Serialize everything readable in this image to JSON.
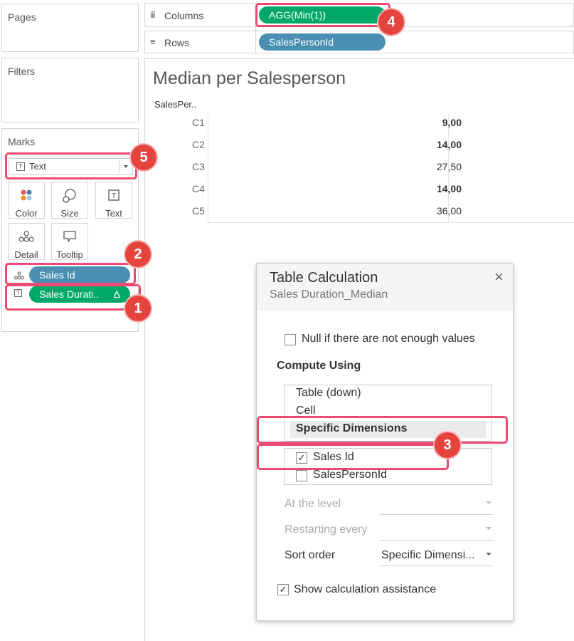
{
  "panels": {
    "pages": "Pages",
    "filters": "Filters",
    "marks": "Marks"
  },
  "shelves": {
    "columns_label": "Columns",
    "rows_label": "Rows",
    "columns_pill": "AGG(Min(1))",
    "rows_pill": "SalesPersonId"
  },
  "marks": {
    "type": "Text",
    "buttons": [
      {
        "label": "Color",
        "icon": "color-icon"
      },
      {
        "label": "Size",
        "icon": "size-icon"
      },
      {
        "label": "Text",
        "icon": "text-icon"
      },
      {
        "label": "Detail",
        "icon": "detail-icon"
      },
      {
        "label": "Tooltip",
        "icon": "tooltip-icon"
      }
    ],
    "fields": [
      {
        "label": "Sales Id",
        "icon": "detail-icon"
      },
      {
        "label": "Sales Durati..",
        "suffix": "Δ",
        "icon": "text-icon"
      }
    ]
  },
  "view": {
    "title": "Median per Salesperson",
    "header": "SalesPer..",
    "rows": [
      {
        "label": "C1",
        "value": "9,00",
        "bold": true
      },
      {
        "label": "C2",
        "value": "14,00",
        "bold": true
      },
      {
        "label": "C3",
        "value": "27,50",
        "bold": false
      },
      {
        "label": "C4",
        "value": "14,00",
        "bold": true
      },
      {
        "label": "C5",
        "value": "36,00",
        "bold": false
      }
    ]
  },
  "dialog": {
    "title": "Table Calculation",
    "subtitle": "Sales Duration_Median",
    "close": "×",
    "null_option": "Null if there are not enough values",
    "compute_heading": "Compute Using",
    "compute_options": [
      "Table (down)",
      "Cell",
      "Specific Dimensions"
    ],
    "dimensions": [
      {
        "label": "Sales Id",
        "checked": true
      },
      {
        "label": "SalesPersonId",
        "checked": false
      }
    ],
    "at_level": "At the level",
    "restarting": "Restarting every",
    "sort_order": "Sort order",
    "sort_value": "Specific Dimensi...",
    "assist": "Show calculation assistance"
  },
  "callouts": [
    "1",
    "2",
    "3",
    "4",
    "5"
  ],
  "colors": {
    "green_pill": "#00a86b",
    "blue_pill": "#4a8fb2",
    "callout": "#ec4a72",
    "badge": "#e5433e"
  }
}
